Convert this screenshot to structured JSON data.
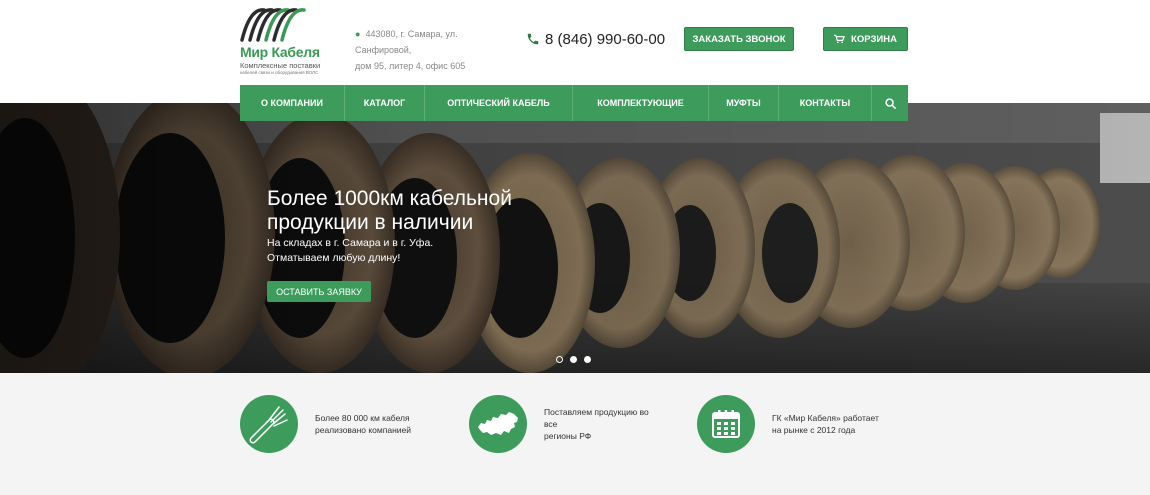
{
  "header": {
    "logo_name": "Мир Кабеля",
    "logo_tagline": "Комплексные поставки",
    "logo_tagline_small": "кабелей связи и оборудования ВОЛС",
    "address_line1": "443080, г. Самара, ул. Санфировой,",
    "address_line2": "дом 95, литер 4, офис 605",
    "phone": "8 (846) 990-60-00",
    "call_button": "Заказать звонок",
    "cart_button": "Корзина"
  },
  "nav": {
    "items": [
      {
        "label": "О компании"
      },
      {
        "label": "Каталог"
      },
      {
        "label": "Оптический кабель"
      },
      {
        "label": "Комплектующие"
      },
      {
        "label": "Муфты"
      },
      {
        "label": "Контакты"
      }
    ],
    "search_icon": "search-icon"
  },
  "hero": {
    "title": "Более 1000км кабельной продукции в наличии",
    "subtitle_line1": "На складах в г. Самара и в г. Уфа.",
    "subtitle_line2": "Отматываем любую длину!",
    "button": "Оставить заявку",
    "slides_count": 3,
    "active_slide": 1
  },
  "features": [
    {
      "icon": "cable-icon",
      "text_line1": "Более 80 000 км кабеля",
      "text_line2": "реализовано компанией"
    },
    {
      "icon": "russia-map-icon",
      "text_line1": "Поставляем продукцию во все",
      "text_line2": "регионы РФ"
    },
    {
      "icon": "calendar-icon",
      "text_line1": "ГК «Мир Кабеля» работает",
      "text_line2": "на рынке с 2012 года"
    }
  ],
  "colors": {
    "brand_green": "#3d9b5c",
    "nav_divider": "#5bb074",
    "features_bg": "#f4f4f4"
  }
}
